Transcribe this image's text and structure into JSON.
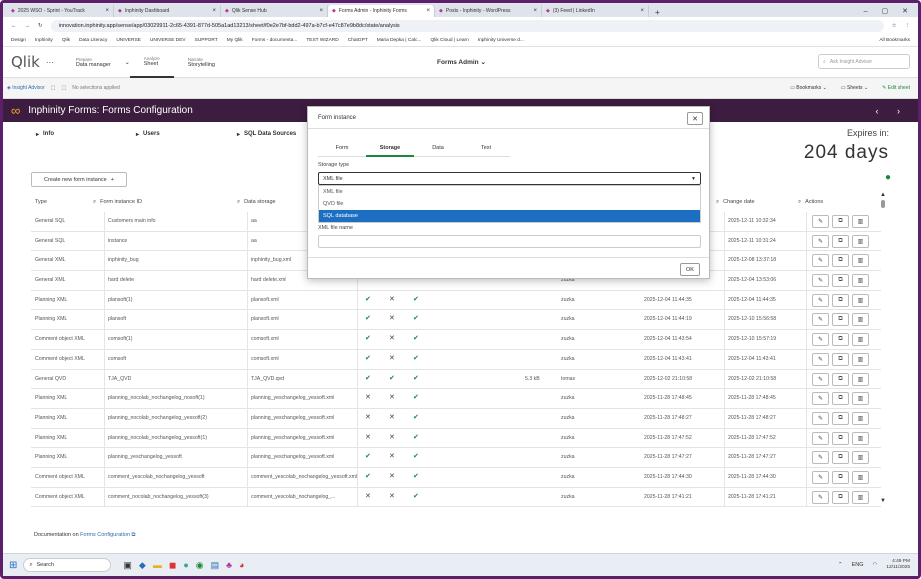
{
  "browser": {
    "tabs": [
      {
        "label": "2025 WSO - Sprint - YouTrack",
        "active": false
      },
      {
        "label": "Inphinity Dashboard",
        "active": false
      },
      {
        "label": "Qlik Sense Hub",
        "active": false
      },
      {
        "label": "Forms Admin - Inphinity Forms",
        "active": true
      },
      {
        "label": "Posts - Inphinity - WordPress",
        "active": false
      },
      {
        "label": "(3) Feed | LinkedIn",
        "active": false
      }
    ],
    "url": "innovation.inphinity.app/sense/app/03029911-2c65-4391-877d-505a1ad13213/sheet/f0e2e7bf-bdd2-497a-b7cf-e47c87e9b8dc/state/analysis",
    "bookmarks": [
      "Design",
      "Inphinity",
      "Qlik",
      "Data Literacy",
      "UNIVERSE",
      "UNIVERSE DEV",
      "SUPPORT",
      "My Qlik",
      "Forms - documenta...",
      "TEST WIZARD",
      "ChatGPT",
      "Maria Depka | Calc...",
      "Qlik Cloud | Learn",
      "Inphinity Universe d..."
    ],
    "all_bookmarks": "All Bookmarks"
  },
  "qlik": {
    "logo": "Qlik",
    "nav": [
      {
        "small": "Prepare",
        "big": "Data manager"
      },
      {
        "small": "Analyze",
        "big": "Sheet"
      },
      {
        "small": "Narrate",
        "big": "Storytelling"
      }
    ],
    "center_title": "Forms Admin",
    "search_placeholder": "Ask Insight Advisor",
    "insight_advisor": "Insight Advisor",
    "no_selections": "No selections applied",
    "bookmarks": "Bookmarks",
    "sheets": "Sheets",
    "edit_sheet": "Edit sheet"
  },
  "app": {
    "title": "Inphinity Forms: Forms Configuration",
    "sections": [
      "Info",
      "Users",
      "SQL Data Sources"
    ],
    "expires_label": "Expires in:",
    "expires_value": "204 days",
    "create_button": "Create new form instance",
    "columns": [
      "Type",
      "Form instance ID",
      "Data storage",
      "Change date",
      "Actions"
    ],
    "rows": [
      {
        "type": "General SQL",
        "id": "Customers main info",
        "storage": "aa",
        "c1": "",
        "c2": "",
        "c3": "",
        "size": "",
        "user": "",
        "d1": "",
        "d2": "2025-12-11 10:32:34"
      },
      {
        "type": "General SQL",
        "id": "instance",
        "storage": "aa",
        "c1": "",
        "c2": "",
        "c3": "",
        "size": "",
        "user": "",
        "d1": "",
        "d2": "2025-12-11 10:31:24"
      },
      {
        "type": "General XML",
        "id": "inphinity_bug",
        "storage": "inphinity_bug.xml",
        "c1": "",
        "c2": "",
        "c3": "",
        "size": "",
        "user": "",
        "d1": "",
        "d2": "2025-12-08 13:37:18"
      },
      {
        "type": "General XML",
        "id": "hard delete",
        "storage": "hard delete.xml",
        "c1": "",
        "c2": "",
        "c3": "",
        "size": "",
        "user": "zuzka",
        "d1": "",
        "d2": "2025-12-04 13:53:06"
      },
      {
        "type": "Planning XML",
        "id": "plansoft(1)",
        "storage": "plansoft.xml",
        "c1": "✔",
        "c2": "✕",
        "c3": "✔",
        "size": "",
        "user": "zuzka",
        "d1": "2025-12-04 11:44:35",
        "d2": "2025-12-04 11:44:35"
      },
      {
        "type": "Planning XML",
        "id": "plansoft",
        "storage": "plansoft.xml",
        "c1": "✔",
        "c2": "✕",
        "c3": "✔",
        "size": "",
        "user": "zuzka",
        "d1": "2025-12-04 11:44:19",
        "d2": "2025-12-10 15:56:58"
      },
      {
        "type": "Comment object XML",
        "id": "comsoft(1)",
        "storage": "comsoft.xml",
        "c1": "✔",
        "c2": "✕",
        "c3": "✔",
        "size": "",
        "user": "zuzka",
        "d1": "2025-12-04 11:43:54",
        "d2": "2025-12-10 15:57:19"
      },
      {
        "type": "Comment object XML",
        "id": "comsoft",
        "storage": "comsoft.xml",
        "c1": "✔",
        "c2": "✕",
        "c3": "✔",
        "size": "",
        "user": "zuzka",
        "d1": "2025-12-04 11:43:41",
        "d2": "2025-12-04 11:43:41"
      },
      {
        "type": "General QVD",
        "id": "TJA_QVD",
        "storage": "TJA_QVD.qvd",
        "c1": "✔",
        "c2": "✔",
        "c3": "✔",
        "size": "5.3 kB",
        "user": "tomas",
        "d1": "2025-12-02 21:10:58",
        "d2": "2025-12-02 21:10:58"
      },
      {
        "type": "Planning XML",
        "id": "planning_nocolab_nochangelog_nosoft(1)",
        "storage": "planning_yeschangelog_yessoft.xml",
        "c1": "✕",
        "c2": "✕",
        "c3": "✔",
        "size": "",
        "user": "zuzka",
        "d1": "2025-11-28 17:48:45",
        "d2": "2025-11-28 17:48:45"
      },
      {
        "type": "Planning XML",
        "id": "planning_nocolab_nochangelog_yessoft(2)",
        "storage": "planning_yeschangelog_yessoft.xml",
        "c1": "✕",
        "c2": "✕",
        "c3": "✔",
        "size": "",
        "user": "zuzka",
        "d1": "2025-11-28 17:48:27",
        "d2": "2025-11-28 17:48:27"
      },
      {
        "type": "Planning XML",
        "id": "planning_nocolab_nochangelog_yessoft(1)",
        "storage": "planning_yeschangelog_yessoft.xml",
        "c1": "✕",
        "c2": "✕",
        "c3": "✔",
        "size": "",
        "user": "zuzka",
        "d1": "2025-11-28 17:47:52",
        "d2": "2025-11-28 17:47:52"
      },
      {
        "type": "Planning XML",
        "id": "planning_yeschangelog_yessoft",
        "storage": "planning_yeschangelog_yessoft.xml",
        "c1": "✔",
        "c2": "✕",
        "c3": "✔",
        "size": "",
        "user": "zuzka",
        "d1": "2025-11-28 17:47:27",
        "d2": "2025-11-28 17:47:27"
      },
      {
        "type": "Comment object XML",
        "id": "comment_yescolab_nochangelog_yessoft",
        "storage": "comment_yescolab_nochangelog_yessoft.xml",
        "c1": "✔",
        "c2": "✕",
        "c3": "✔",
        "size": "",
        "user": "zuzka",
        "d1": "2025-11-28 17:44:30",
        "d2": "2025-11-28 17:44:30"
      },
      {
        "type": "Comment object XML",
        "id": "comment_nocolab_nochangelog_yessoft(3)",
        "storage": "comment_yescolab_nochangelog_...",
        "c1": "✕",
        "c2": "✕",
        "c3": "✔",
        "size": "",
        "user": "zuzka",
        "d1": "2025-11-28 17:41:21",
        "d2": "2025-11-28 17:41:21"
      }
    ],
    "documentation_prefix": "Documentation on",
    "documentation_link": "Forms Configuration"
  },
  "dialog": {
    "title": "Form instance",
    "tabs": [
      "Form",
      "Storage",
      "Data",
      "Text"
    ],
    "active_tab": "Storage",
    "storage_type_label": "Storage type",
    "selected_value": "XML file",
    "options": [
      "XML file",
      "QVD file",
      "SQL database"
    ],
    "highlighted_option": "SQL database",
    "file_name_label": "XML file name",
    "ok": "OK"
  },
  "taskbar": {
    "search": "Search",
    "lang": "ENG",
    "time": "4:49 PM",
    "date": "12/11/2025"
  },
  "colors": {
    "title_bar": "#3d1d3f",
    "accent_green": "#1a8a3a",
    "select_blue": "#1b6ec2",
    "frame": "#5b1f6b"
  }
}
